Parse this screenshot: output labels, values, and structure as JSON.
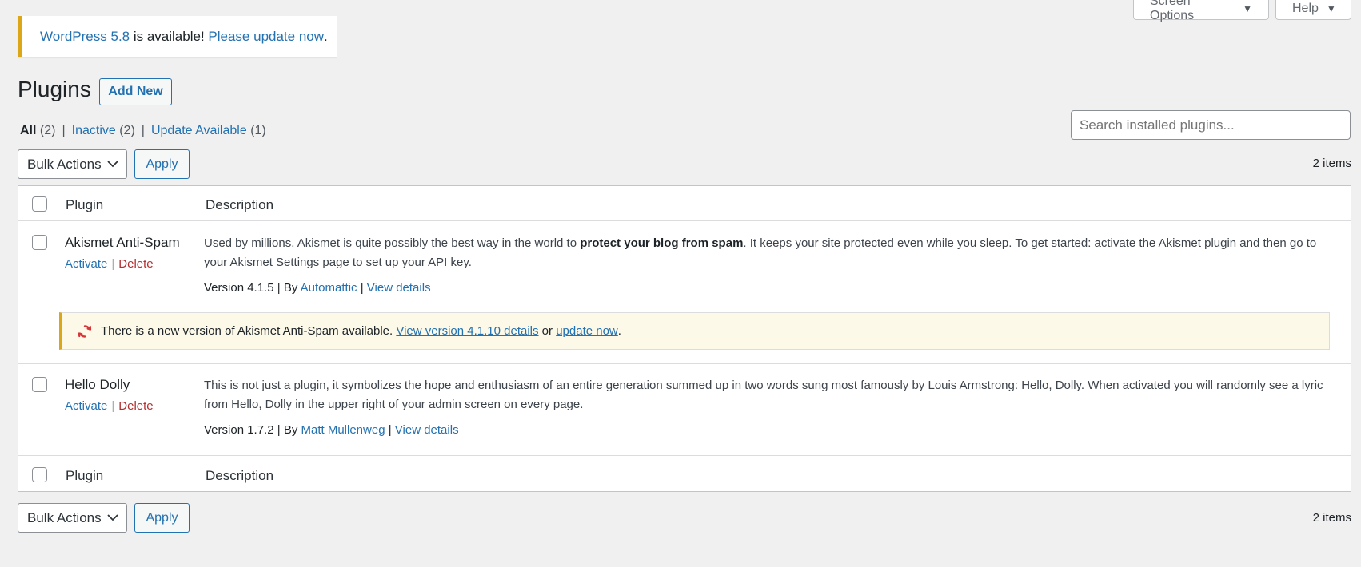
{
  "screen_meta": {
    "screen_options_label": "Screen Options",
    "help_label": "Help"
  },
  "update_nag": {
    "version_link": "WordPress 5.8",
    "middle_text": " is available! ",
    "update_link": "Please update now",
    "end_text": "."
  },
  "page": {
    "title": "Plugins",
    "add_new_label": "Add New"
  },
  "filters": [
    {
      "label": "All",
      "count": "(2)"
    },
    {
      "label": "Inactive",
      "count": "(2)"
    },
    {
      "label": "Update Available",
      "count": "(1)"
    }
  ],
  "search": {
    "placeholder": "Search installed plugins..."
  },
  "bulk": {
    "select_label": "Bulk Actions",
    "apply_label": "Apply",
    "items_count": "2 items"
  },
  "table": {
    "col_plugin": "Plugin",
    "col_description": "Description",
    "rows": [
      {
        "name": "Akismet Anti-Spam",
        "activate": "Activate",
        "delete": "Delete",
        "desc_before": "Used by millions, Akismet is quite possibly the best way in the world to ",
        "desc_bold": "protect your blog from spam",
        "desc_after": ". It keeps your site protected even while you sleep. To get started: activate the Akismet plugin and then go to your Akismet Settings page to set up your API key.",
        "version": "Version 4.1.5",
        "by": "By",
        "author": "Automattic",
        "view_details": "View details",
        "update_notice": {
          "text": "There is a new version of Akismet Anti-Spam available. ",
          "details_link": "View version 4.1.10 details",
          "or": " or ",
          "update_link": "update now",
          "end": "."
        }
      },
      {
        "name": "Hello Dolly",
        "activate": "Activate",
        "delete": "Delete",
        "desc": "This is not just a plugin, it symbolizes the hope and enthusiasm of an entire generation summed up in two words sung most famously by Louis Armstrong: Hello, Dolly. When activated you will randomly see a lyric from Hello, Dolly in the upper right of your admin screen on every page.",
        "version": "Version 1.7.2",
        "by": "By",
        "author": "Matt Mullenweg",
        "view_details": "View details"
      }
    ]
  },
  "colors": {
    "link": "#2271b1",
    "delete": "#b32d2e",
    "notice_border": "#dba617",
    "update_icon": "#d63638"
  },
  "icons": {
    "screen_options_caret": "caret-down-icon",
    "help_caret": "caret-down-icon",
    "select_chevron": "chevron-down-icon",
    "update_icon": "update-icon"
  }
}
